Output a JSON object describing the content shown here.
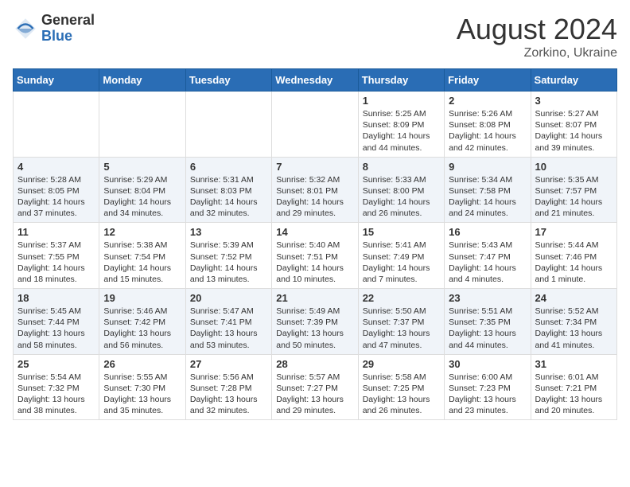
{
  "header": {
    "logo_general": "General",
    "logo_blue": "Blue",
    "month_title": "August 2024",
    "subtitle": "Zorkino, Ukraine"
  },
  "weekdays": [
    "Sunday",
    "Monday",
    "Tuesday",
    "Wednesday",
    "Thursday",
    "Friday",
    "Saturday"
  ],
  "weeks": [
    [
      {
        "day": "",
        "info": ""
      },
      {
        "day": "",
        "info": ""
      },
      {
        "day": "",
        "info": ""
      },
      {
        "day": "",
        "info": ""
      },
      {
        "day": "1",
        "info": "Sunrise: 5:25 AM\nSunset: 8:09 PM\nDaylight: 14 hours\nand 44 minutes."
      },
      {
        "day": "2",
        "info": "Sunrise: 5:26 AM\nSunset: 8:08 PM\nDaylight: 14 hours\nand 42 minutes."
      },
      {
        "day": "3",
        "info": "Sunrise: 5:27 AM\nSunset: 8:07 PM\nDaylight: 14 hours\nand 39 minutes."
      }
    ],
    [
      {
        "day": "4",
        "info": "Sunrise: 5:28 AM\nSunset: 8:05 PM\nDaylight: 14 hours\nand 37 minutes."
      },
      {
        "day": "5",
        "info": "Sunrise: 5:29 AM\nSunset: 8:04 PM\nDaylight: 14 hours\nand 34 minutes."
      },
      {
        "day": "6",
        "info": "Sunrise: 5:31 AM\nSunset: 8:03 PM\nDaylight: 14 hours\nand 32 minutes."
      },
      {
        "day": "7",
        "info": "Sunrise: 5:32 AM\nSunset: 8:01 PM\nDaylight: 14 hours\nand 29 minutes."
      },
      {
        "day": "8",
        "info": "Sunrise: 5:33 AM\nSunset: 8:00 PM\nDaylight: 14 hours\nand 26 minutes."
      },
      {
        "day": "9",
        "info": "Sunrise: 5:34 AM\nSunset: 7:58 PM\nDaylight: 14 hours\nand 24 minutes."
      },
      {
        "day": "10",
        "info": "Sunrise: 5:35 AM\nSunset: 7:57 PM\nDaylight: 14 hours\nand 21 minutes."
      }
    ],
    [
      {
        "day": "11",
        "info": "Sunrise: 5:37 AM\nSunset: 7:55 PM\nDaylight: 14 hours\nand 18 minutes."
      },
      {
        "day": "12",
        "info": "Sunrise: 5:38 AM\nSunset: 7:54 PM\nDaylight: 14 hours\nand 15 minutes."
      },
      {
        "day": "13",
        "info": "Sunrise: 5:39 AM\nSunset: 7:52 PM\nDaylight: 14 hours\nand 13 minutes."
      },
      {
        "day": "14",
        "info": "Sunrise: 5:40 AM\nSunset: 7:51 PM\nDaylight: 14 hours\nand 10 minutes."
      },
      {
        "day": "15",
        "info": "Sunrise: 5:41 AM\nSunset: 7:49 PM\nDaylight: 14 hours\nand 7 minutes."
      },
      {
        "day": "16",
        "info": "Sunrise: 5:43 AM\nSunset: 7:47 PM\nDaylight: 14 hours\nand 4 minutes."
      },
      {
        "day": "17",
        "info": "Sunrise: 5:44 AM\nSunset: 7:46 PM\nDaylight: 14 hours\nand 1 minute."
      }
    ],
    [
      {
        "day": "18",
        "info": "Sunrise: 5:45 AM\nSunset: 7:44 PM\nDaylight: 13 hours\nand 58 minutes."
      },
      {
        "day": "19",
        "info": "Sunrise: 5:46 AM\nSunset: 7:42 PM\nDaylight: 13 hours\nand 56 minutes."
      },
      {
        "day": "20",
        "info": "Sunrise: 5:47 AM\nSunset: 7:41 PM\nDaylight: 13 hours\nand 53 minutes."
      },
      {
        "day": "21",
        "info": "Sunrise: 5:49 AM\nSunset: 7:39 PM\nDaylight: 13 hours\nand 50 minutes."
      },
      {
        "day": "22",
        "info": "Sunrise: 5:50 AM\nSunset: 7:37 PM\nDaylight: 13 hours\nand 47 minutes."
      },
      {
        "day": "23",
        "info": "Sunrise: 5:51 AM\nSunset: 7:35 PM\nDaylight: 13 hours\nand 44 minutes."
      },
      {
        "day": "24",
        "info": "Sunrise: 5:52 AM\nSunset: 7:34 PM\nDaylight: 13 hours\nand 41 minutes."
      }
    ],
    [
      {
        "day": "25",
        "info": "Sunrise: 5:54 AM\nSunset: 7:32 PM\nDaylight: 13 hours\nand 38 minutes."
      },
      {
        "day": "26",
        "info": "Sunrise: 5:55 AM\nSunset: 7:30 PM\nDaylight: 13 hours\nand 35 minutes."
      },
      {
        "day": "27",
        "info": "Sunrise: 5:56 AM\nSunset: 7:28 PM\nDaylight: 13 hours\nand 32 minutes."
      },
      {
        "day": "28",
        "info": "Sunrise: 5:57 AM\nSunset: 7:27 PM\nDaylight: 13 hours\nand 29 minutes."
      },
      {
        "day": "29",
        "info": "Sunrise: 5:58 AM\nSunset: 7:25 PM\nDaylight: 13 hours\nand 26 minutes."
      },
      {
        "day": "30",
        "info": "Sunrise: 6:00 AM\nSunset: 7:23 PM\nDaylight: 13 hours\nand 23 minutes."
      },
      {
        "day": "31",
        "info": "Sunrise: 6:01 AM\nSunset: 7:21 PM\nDaylight: 13 hours\nand 20 minutes."
      }
    ]
  ]
}
